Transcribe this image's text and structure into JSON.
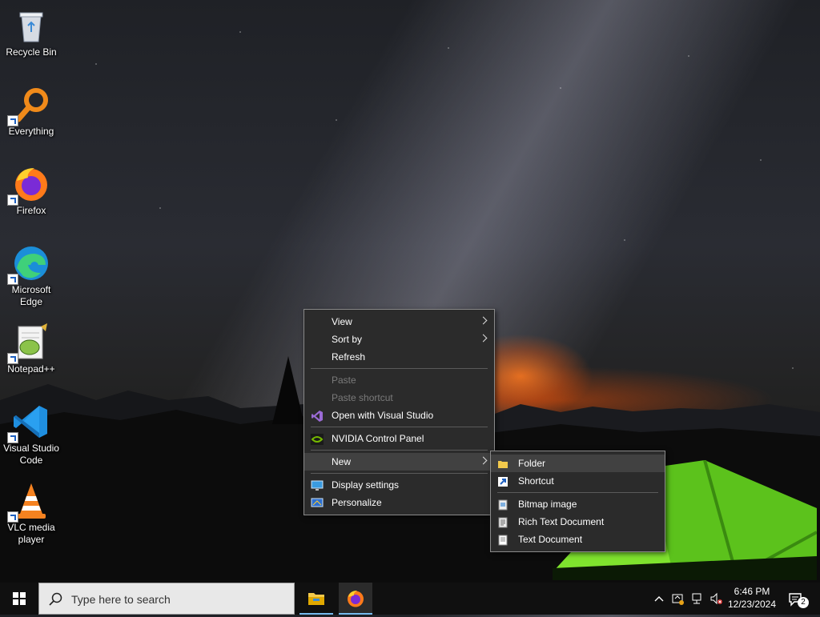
{
  "desktop": {
    "icons": [
      {
        "id": "recycle-bin",
        "label": "Recycle Bin",
        "icon": "recycle-bin-icon"
      },
      {
        "id": "everything",
        "label": "Everything",
        "icon": "magnifier-icon"
      },
      {
        "id": "firefox",
        "label": "Firefox",
        "icon": "firefox-icon"
      },
      {
        "id": "edge",
        "label": "Microsoft Edge",
        "icon": "edge-icon"
      },
      {
        "id": "notepadpp",
        "label": "Notepad++",
        "icon": "notepad-plus-plus-icon"
      },
      {
        "id": "vscode",
        "label": "Visual Studio Code",
        "icon": "vscode-icon"
      },
      {
        "id": "vlc",
        "label": "VLC media player",
        "icon": "vlc-cone-icon"
      }
    ]
  },
  "context_menu": {
    "view": "View",
    "sort_by": "Sort by",
    "refresh": "Refresh",
    "paste": "Paste",
    "paste_shortcut": "Paste shortcut",
    "open_visual_studio": "Open with Visual Studio",
    "nvidia": "NVIDIA Control Panel",
    "new": "New",
    "display_settings": "Display settings",
    "personalize": "Personalize"
  },
  "new_submenu": {
    "folder": "Folder",
    "shortcut": "Shortcut",
    "bitmap": "Bitmap image",
    "rich_text": "Rich Text Document",
    "text_doc": "Text Document"
  },
  "taskbar": {
    "search_placeholder": "Type here to search",
    "time": "6:46 PM",
    "date": "12/23/2024",
    "notification_count": "2",
    "accent_color": "#76b9ed"
  }
}
